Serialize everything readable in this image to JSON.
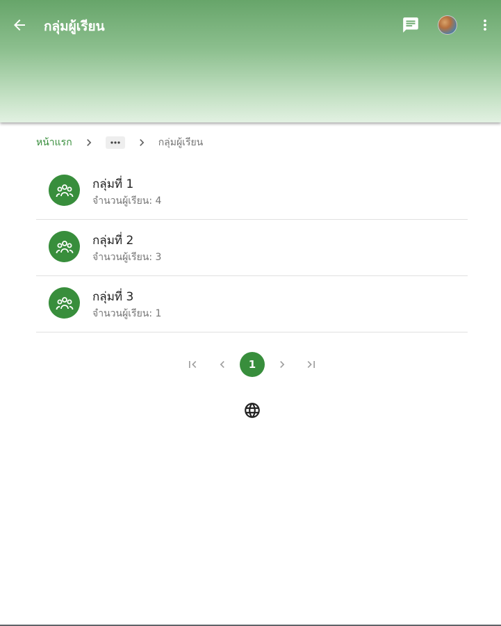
{
  "app_bar": {
    "title": "กลุ่มผู้เรียน",
    "icons": [
      "arrow-back-icon",
      "chat-icon",
      "avatar",
      "more-vert-icon"
    ],
    "gradient_top": "#67a56a",
    "gradient_bottom": "#e2f1e2"
  },
  "breadcrumb": {
    "home": "หน้าแรก",
    "more": "•••",
    "current": "กลุ่มผู้เรียน"
  },
  "groups": [
    {
      "name": "กลุ่มที่ 1",
      "count_text": "จำนวนผู้เรียน: 4"
    },
    {
      "name": "กลุ่มที่ 2",
      "count_text": "จำนวนผู้เรียน: 3"
    },
    {
      "name": "กลุ่มที่ 3",
      "count_text": "จำนวนผู้เรียน: 1"
    }
  ],
  "pagination": {
    "current_page": "1",
    "icons": [
      "first-page-icon",
      "prev-page-icon",
      "next-page-icon",
      "last-page-icon"
    ]
  },
  "footer": {
    "icon": "globe-icon"
  },
  "colors": {
    "accent": "#388e3c",
    "muted": "#757575",
    "divider": "#e0e0e0"
  }
}
